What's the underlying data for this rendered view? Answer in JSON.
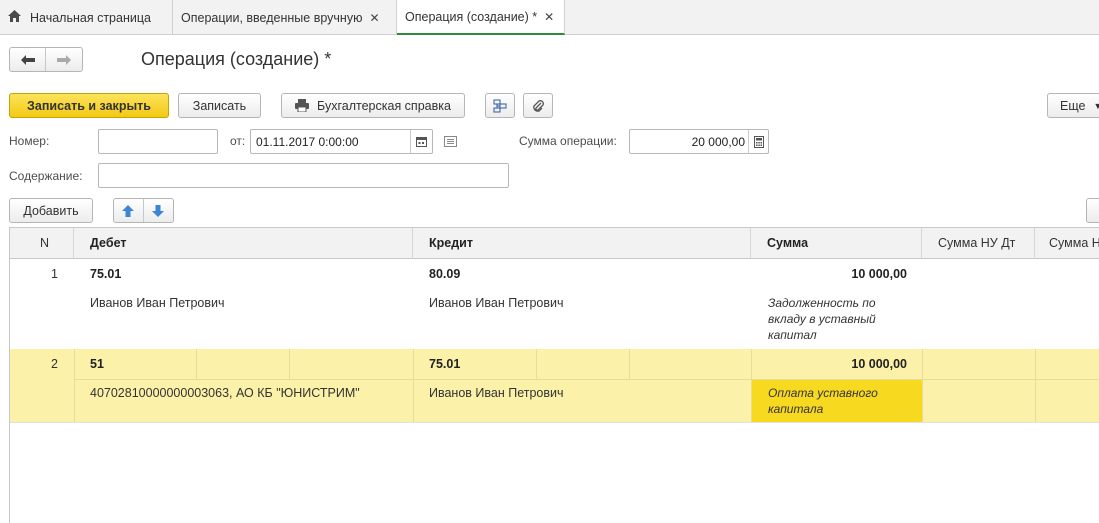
{
  "tabs": [
    {
      "label": "Начальная страница"
    },
    {
      "label": "Операции, введенные вручную"
    },
    {
      "label": "Операция (создание) *"
    }
  ],
  "header": {
    "title": "Операция (создание) *"
  },
  "toolbar": {
    "save_close": "Записать и закрыть",
    "save": "Записать",
    "report": "Бухгалтерская справка",
    "more": "Еще"
  },
  "form": {
    "number_label": "Номер:",
    "number_value": "",
    "date_label": "от:",
    "date_value": "01.11.2017  0:00:00",
    "sum_label": "Сумма операции:",
    "sum_value": "20 000,00",
    "content_label": "Содержание:",
    "content_value": ""
  },
  "table_toolbar": {
    "add": "Добавить"
  },
  "table": {
    "headers": [
      "N",
      "Дебет",
      "Кредит",
      "Сумма",
      "Сумма НУ Дт",
      "Сумма Н"
    ],
    "rows": [
      {
        "n": "1",
        "debit_account": "75.01",
        "debit_sub": "Иванов Иван Петрович",
        "credit_account": "80.09",
        "credit_sub": "Иванов Иван Петрович",
        "amount": "10 000,00",
        "comment_lines": [
          "Задолженность по",
          "вкладу в уставный",
          "капитал"
        ]
      },
      {
        "n": "2",
        "debit_account": "51",
        "debit_sub": "40702810000000003063, АО КБ \"ЮНИСТРИМ\"",
        "credit_account": "75.01",
        "credit_sub": "Иванов Иван Петрович",
        "amount": "10 000,00",
        "comment_lines": [
          "Оплата уставного",
          "капитала"
        ]
      }
    ]
  },
  "colors": {
    "accent": "#f5cf1f",
    "selected_row": "#fbf1a8",
    "active_cell": "#f7d920",
    "tab_underline": "#2e8b3d"
  }
}
